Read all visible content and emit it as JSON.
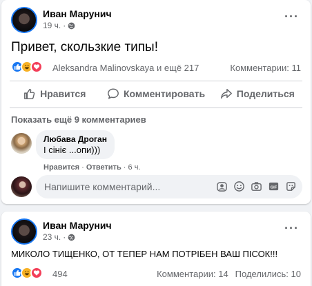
{
  "post1": {
    "author": "Иван Марунич",
    "time": "19 ч.",
    "text": "Привет, скользкие типы!",
    "reactions_text": "Aleksandra Malinovskaya и ещё 217",
    "comments_count": "Комментарии: 11",
    "actions": {
      "like": "Нравится",
      "comment": "Комментировать",
      "share": "Поделиться"
    },
    "show_more": "Показать ещё 9 комментариев",
    "comment": {
      "author": "Любава Дроган",
      "text": "І сініє ...опи)))",
      "like": "Нравится",
      "reply": "Ответить",
      "time": "6 ч."
    },
    "composer": {
      "placeholder": "Напишите комментарий..."
    }
  },
  "post2": {
    "author": "Иван Марунич",
    "time": "23 ч.",
    "text": "МИКОЛО ТИЩЕНКО, ОТ ТЕПЕР НАМ ПОТРІБЕН ВАШ ПІСОК!!!",
    "reactions_count": "494",
    "comments_count": "Комментарии: 14",
    "shares_count": "Поделились: 10"
  },
  "colors": {
    "accent": "#1877f2",
    "muted": "#65676b",
    "love": "#f33e58",
    "haha": "#f7b125"
  }
}
